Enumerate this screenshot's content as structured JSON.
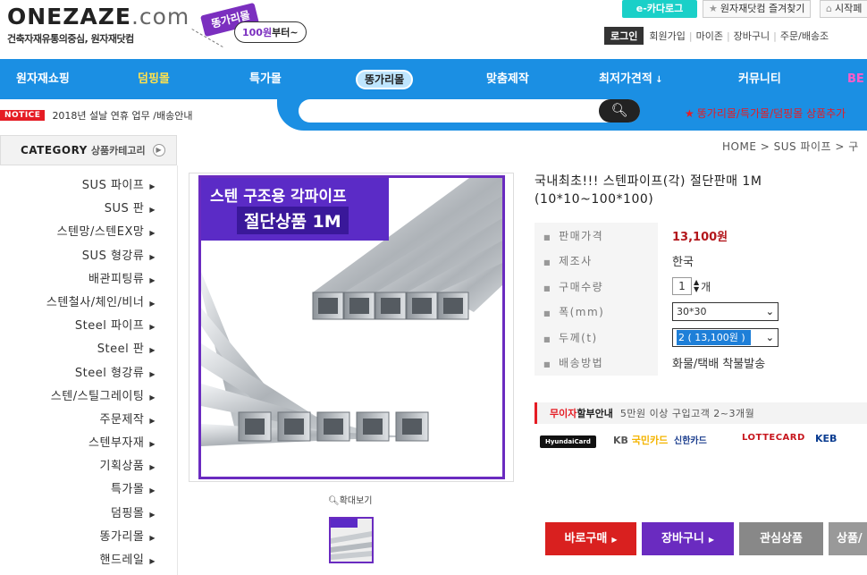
{
  "header": {
    "logo_main": "ONEZAZE",
    "logo_com": ".com",
    "logo_tagline": "건축자재유통의중심, 원자재닷컴",
    "promo_tag": "똥가리몰",
    "promo_price": "100원",
    "promo_suffix": "부터~",
    "ecatalog": "e-카다로그",
    "bookmark": "원자재닷컴 즐겨찾기",
    "homepage": "시작페",
    "util": {
      "login": "로그인",
      "join": "회원가입",
      "mypage": "마이존",
      "cart": "장바구니",
      "order": "주문/배송조"
    }
  },
  "nav": {
    "items": [
      "원자재쇼핑",
      "덤핑몰",
      "특가몰",
      "똥가리몰",
      "맞춤제작",
      "최저가",
      "견적",
      "커뮤니티",
      "BE"
    ]
  },
  "notice": {
    "badge": "NOTICE",
    "text": "2018년 설날 연휴 업무 /배송안내"
  },
  "promo_right": "똥가리몰/특가몰/덤핑몰 상품추가",
  "breadcrumb": "HOME > SUS 파이프 > 구",
  "sidebar": {
    "title": "CATEGORY",
    "subtitle": "상품카테고리",
    "items": [
      "SUS 파이프",
      "SUS 판",
      "스텐망/스텐EX망",
      "SUS 형강류",
      "배관피팅류",
      "스텐철사/체인/비너",
      "Steel 파이프",
      "Steel 판",
      "Steel 형강류",
      "스텐/스틸그레이팅",
      "주문제작",
      "스텐부자재",
      "기획상품",
      "특가몰",
      "덤핑몰",
      "똥가리몰",
      "핸드레일"
    ]
  },
  "product": {
    "image_banner_line1": "스텐 구조용 각파이프",
    "image_banner_line2": "절단상품 1M",
    "zoom_label": "확대보기",
    "title": "국내최초!!! 스텐파이프(각) 절단판매 1M (10*10~100*100)",
    "labels": {
      "price": "판매가격",
      "maker": "제조사",
      "qty": "구매수량",
      "width": "폭(mm)",
      "thickness": "두께(t)",
      "shipping": "배송방법"
    },
    "price": "13,100원",
    "maker": "한국",
    "qty_value": "1",
    "qty_unit": "개",
    "width_selected": "30*30",
    "thickness_selected": "2 ( 13,100원 )",
    "shipping": "화물/택배 착불발송"
  },
  "installment": {
    "label_red": "무이자",
    "label_bold": "할부안내",
    "text": "5만원 이상 구입고객 2~3개월"
  },
  "cards": [
    "HyundaiCard",
    "KB",
    "국민카드",
    "신한카드",
    "LOTTECARD",
    "KEB"
  ],
  "buttons": {
    "buy": "바로구매",
    "cart": "장바구니",
    "wish": "관심상품",
    "qa": "상품/"
  }
}
